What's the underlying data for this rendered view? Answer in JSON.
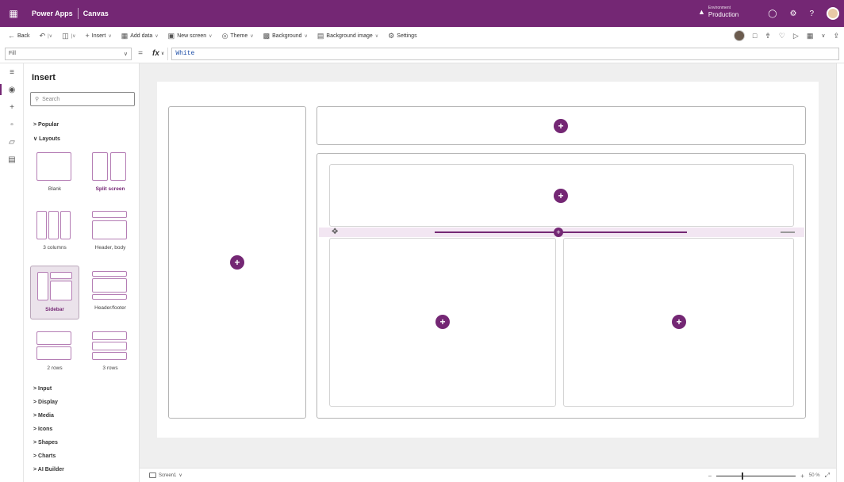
{
  "topbar": {
    "app_name": "Power Apps",
    "mode": "Canvas",
    "environment_label": "Environment",
    "environment_value": "Production",
    "icons": [
      "waffle-icon",
      "environment-icon",
      "bell-icon",
      "settings-icon",
      "help-icon",
      "avatar"
    ]
  },
  "commandbar": {
    "back": "Back",
    "insert": "Insert",
    "add_data": "Add data",
    "new_screen": "New screen",
    "theme": "Theme",
    "background": "Background",
    "background_image": "Background image",
    "settings": "Settings"
  },
  "formulabar": {
    "property": "Fill",
    "fx": "fx",
    "formula": "White"
  },
  "insert_panel": {
    "title": "Insert",
    "search_placeholder": "Search",
    "popular": "Popular",
    "layouts": "Layouts",
    "layout_items": [
      {
        "label": "Blank"
      },
      {
        "label": "Split screen"
      },
      {
        "label": "3 columns"
      },
      {
        "label": "Header, body"
      },
      {
        "label": "Sidebar"
      },
      {
        "label": "Header/footer"
      },
      {
        "label": "2 rows"
      },
      {
        "label": "3 rows"
      }
    ],
    "categories": [
      "Input",
      "Display",
      "Media",
      "Icons",
      "Shapes",
      "Charts",
      "AI Builder"
    ]
  },
  "bottombar": {
    "screen": "Screen1",
    "zoom": "50 %"
  },
  "colors": {
    "brand": "#742774",
    "canvas_bg": "#efefef"
  }
}
